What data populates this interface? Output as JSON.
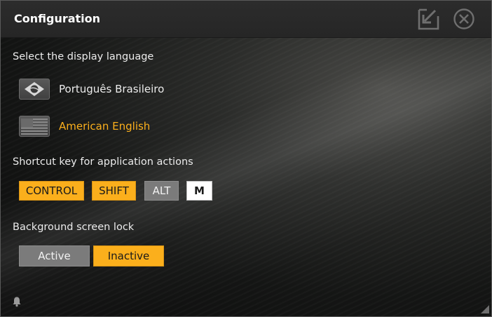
{
  "window": {
    "title": "Configuration"
  },
  "titlebar": {
    "minimize_icon": "arrow-down-left-icon",
    "close_icon": "circle-x-icon"
  },
  "language": {
    "label": "Select the display language",
    "options": [
      {
        "label": "Português Brasileiro",
        "icon": "brazil-flag-icon",
        "selected": false,
        "color": "#ececec"
      },
      {
        "label": "American English",
        "icon": "usa-flag-icon",
        "selected": true,
        "color": "#fbaf1c"
      }
    ]
  },
  "shortcut": {
    "label": "Shortcut key for application actions",
    "keys": [
      {
        "label": "CONTROL",
        "active": true
      },
      {
        "label": "SHIFT",
        "active": true
      },
      {
        "label": "ALT",
        "active": false
      },
      {
        "label": "M",
        "active": false
      }
    ]
  },
  "lock": {
    "label": "Background screen lock",
    "options": [
      {
        "label": "Active",
        "selected": false
      },
      {
        "label": "Inactive",
        "selected": true
      }
    ]
  },
  "colors": {
    "accent": "#fbaf1c",
    "inactive": "#7b7b7b"
  }
}
